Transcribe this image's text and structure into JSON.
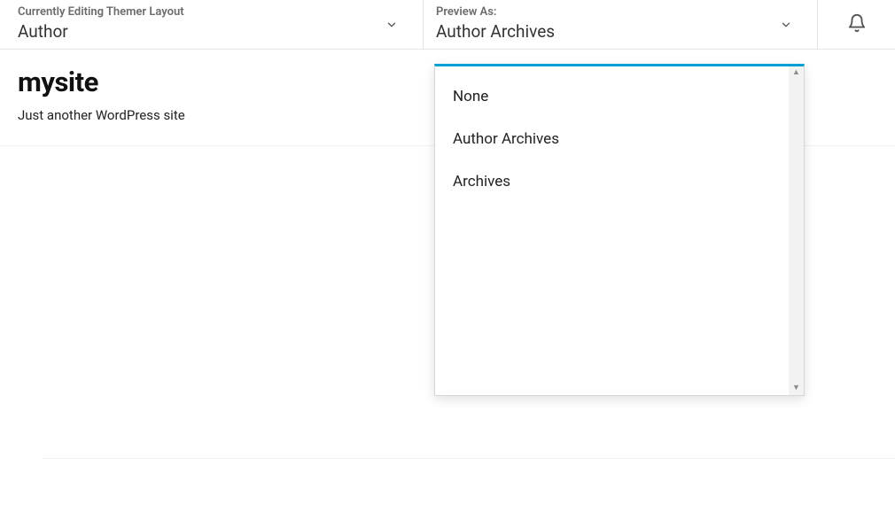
{
  "topbar": {
    "editing": {
      "label": "Currently Editing Themer Layout",
      "value": "Author"
    },
    "preview": {
      "label": "Preview As:",
      "value": "Author Archives"
    }
  },
  "site": {
    "title": "mysite",
    "tagline": "Just another WordPress site"
  },
  "dropdown": {
    "items": [
      "None",
      "Author Archives",
      "Archives"
    ]
  }
}
